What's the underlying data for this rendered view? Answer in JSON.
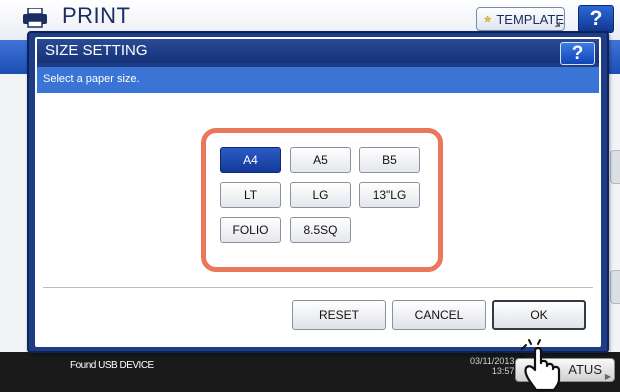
{
  "background": {
    "title": "PRINT",
    "template_label": "TEMPLATE",
    "help_label": "?",
    "status_message": "Found USB DEVICE",
    "clock_date": "03/11/2013",
    "clock_time": "13:57",
    "job_status_label": "ATUS"
  },
  "dialog": {
    "title": "SIZE SETTING",
    "help_label": "?",
    "message": "Select a paper size.",
    "paper_sizes": [
      {
        "label": "A4",
        "selected": true
      },
      {
        "label": "A5",
        "selected": false
      },
      {
        "label": "B5",
        "selected": false
      },
      {
        "label": "LT",
        "selected": false
      },
      {
        "label": "LG",
        "selected": false
      },
      {
        "label": "13\"LG",
        "selected": false
      },
      {
        "label": "FOLIO",
        "selected": false
      },
      {
        "label": "8.5SQ",
        "selected": false
      }
    ],
    "reset_label": "RESET",
    "cancel_label": "CANCEL",
    "ok_label": "OK"
  },
  "colors": {
    "dialog_frame": "#1f3d86",
    "message_bar": "#3a74d4",
    "selected_button": "#143a99",
    "highlight": "#e8775c"
  },
  "icons": [
    "printer-icon",
    "star-icon",
    "help-icon",
    "pointer-hand-icon"
  ]
}
